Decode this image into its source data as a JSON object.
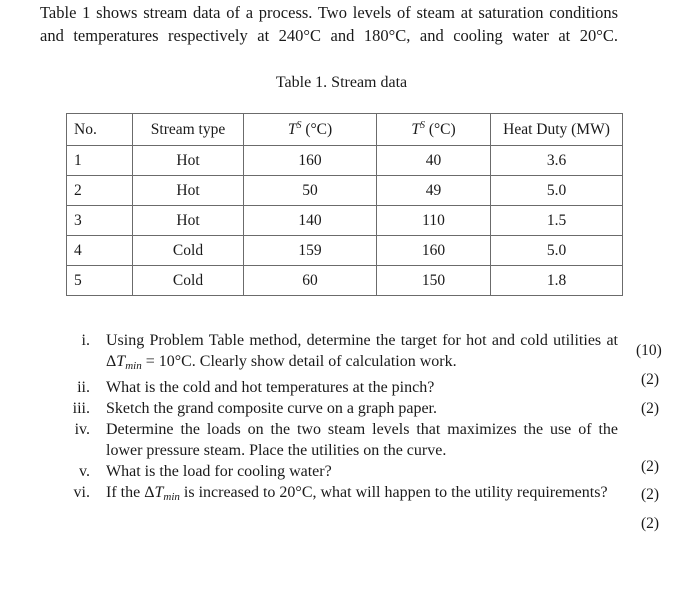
{
  "intro": {
    "line1": "Table 1 shows stream data of a process. Two levels of steam at saturation conditions",
    "line2": "and temperatures respectively at 240°C and 180°C, and cooling water at 20°C."
  },
  "table": {
    "caption": "Table 1. Stream data",
    "headers": {
      "no": "No.",
      "type": "Stream type",
      "t_supply_sym": "T",
      "t_supply_sup": "S",
      "t_supply_unit": " (°C)",
      "t_target_sym": "T",
      "t_target_sup": "S",
      "t_target_unit": " (°C)",
      "duty": "Heat Duty (MW)"
    },
    "rows": [
      {
        "no": "1",
        "type": "Hot",
        "ts": "160",
        "tt": "40",
        "duty": "3.6"
      },
      {
        "no": "2",
        "type": "Hot",
        "ts": "50",
        "tt": "49",
        "duty": "5.0"
      },
      {
        "no": "3",
        "type": "Hot",
        "ts": "140",
        "tt": "110",
        "duty": "1.5"
      },
      {
        "no": "4",
        "type": "Cold",
        "ts": "159",
        "tt": "160",
        "duty": "5.0"
      },
      {
        "no": "5",
        "type": "Cold",
        "ts": "60",
        "tt": "150",
        "duty": "1.8"
      }
    ]
  },
  "questions": [
    {
      "num": "i.",
      "text_a": "Using Problem Table method, determine the target for hot and cold utilities at Δ",
      "text_T": "T",
      "text_sub": "min",
      "text_b": " = 10°C. Clearly show detail of calculation work."
    },
    {
      "num": "ii.",
      "text": "What is the cold and hot temperatures at the pinch?"
    },
    {
      "num": "iii.",
      "text": "Sketch the grand composite curve on a graph paper."
    },
    {
      "num": "iv.",
      "text": "Determine the loads on the two steam levels that maximizes the use of the lower pressure steam. Place the utilities on the curve."
    },
    {
      "num": "v.",
      "text": "What is the load for cooling water?"
    },
    {
      "num": "vi.",
      "text_a": "If the Δ",
      "text_T": "T",
      "text_sub": "min",
      "text_b": " is increased to 20°C, what will happen to the utility requirements?"
    }
  ],
  "marks": [
    "(10)",
    "(2)",
    "(2)",
    "(2)",
    "(2)",
    "(2)"
  ]
}
